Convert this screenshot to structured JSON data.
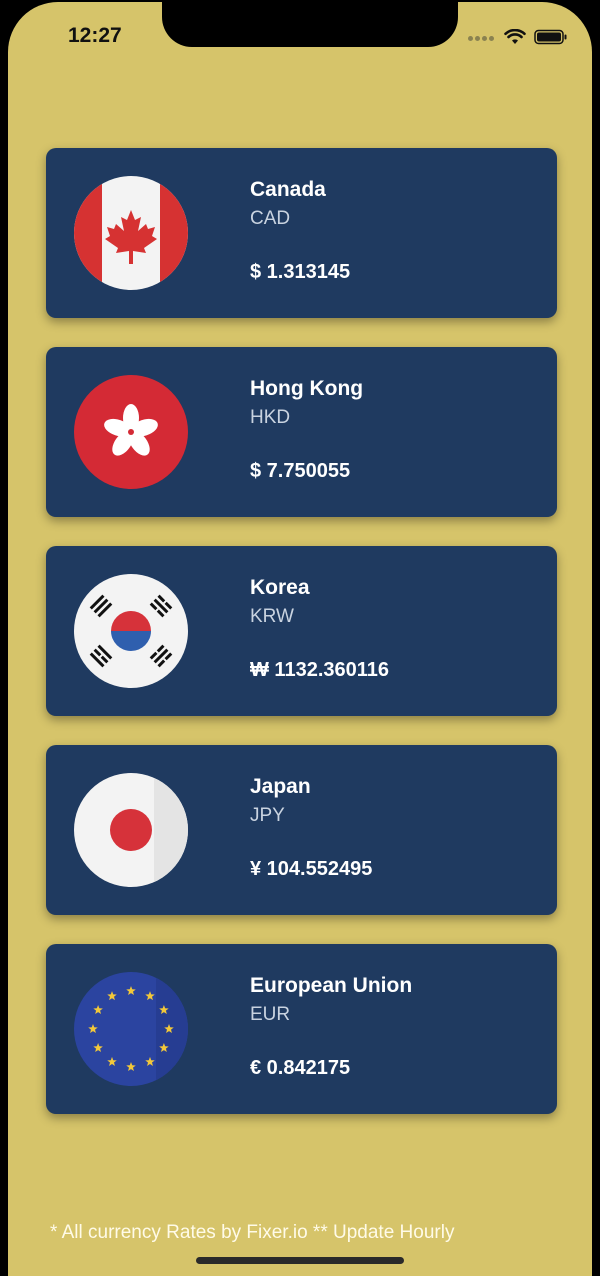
{
  "status_bar": {
    "time": "12:27"
  },
  "colors": {
    "background": "#d6c46a",
    "card": "#1f3a60"
  },
  "currencies": [
    {
      "country": "Canada",
      "code": "CAD",
      "rate": "$ 1.313145",
      "flag": "canada-flag-icon"
    },
    {
      "country": "Hong Kong",
      "code": "HKD",
      "rate": "$ 7.750055",
      "flag": "hong-kong-flag-icon"
    },
    {
      "country": "Korea",
      "code": "KRW",
      "rate": "₩ 1132.360116",
      "flag": "korea-flag-icon"
    },
    {
      "country": "Japan",
      "code": "JPY",
      "rate": "¥ 104.552495",
      "flag": "japan-flag-icon"
    },
    {
      "country": "European Union",
      "code": "EUR",
      "rate": "€ 0.842175",
      "flag": "eu-flag-icon"
    }
  ],
  "footer": {
    "text": "* All currency Rates by Fixer.io  ** Update Hourly"
  }
}
